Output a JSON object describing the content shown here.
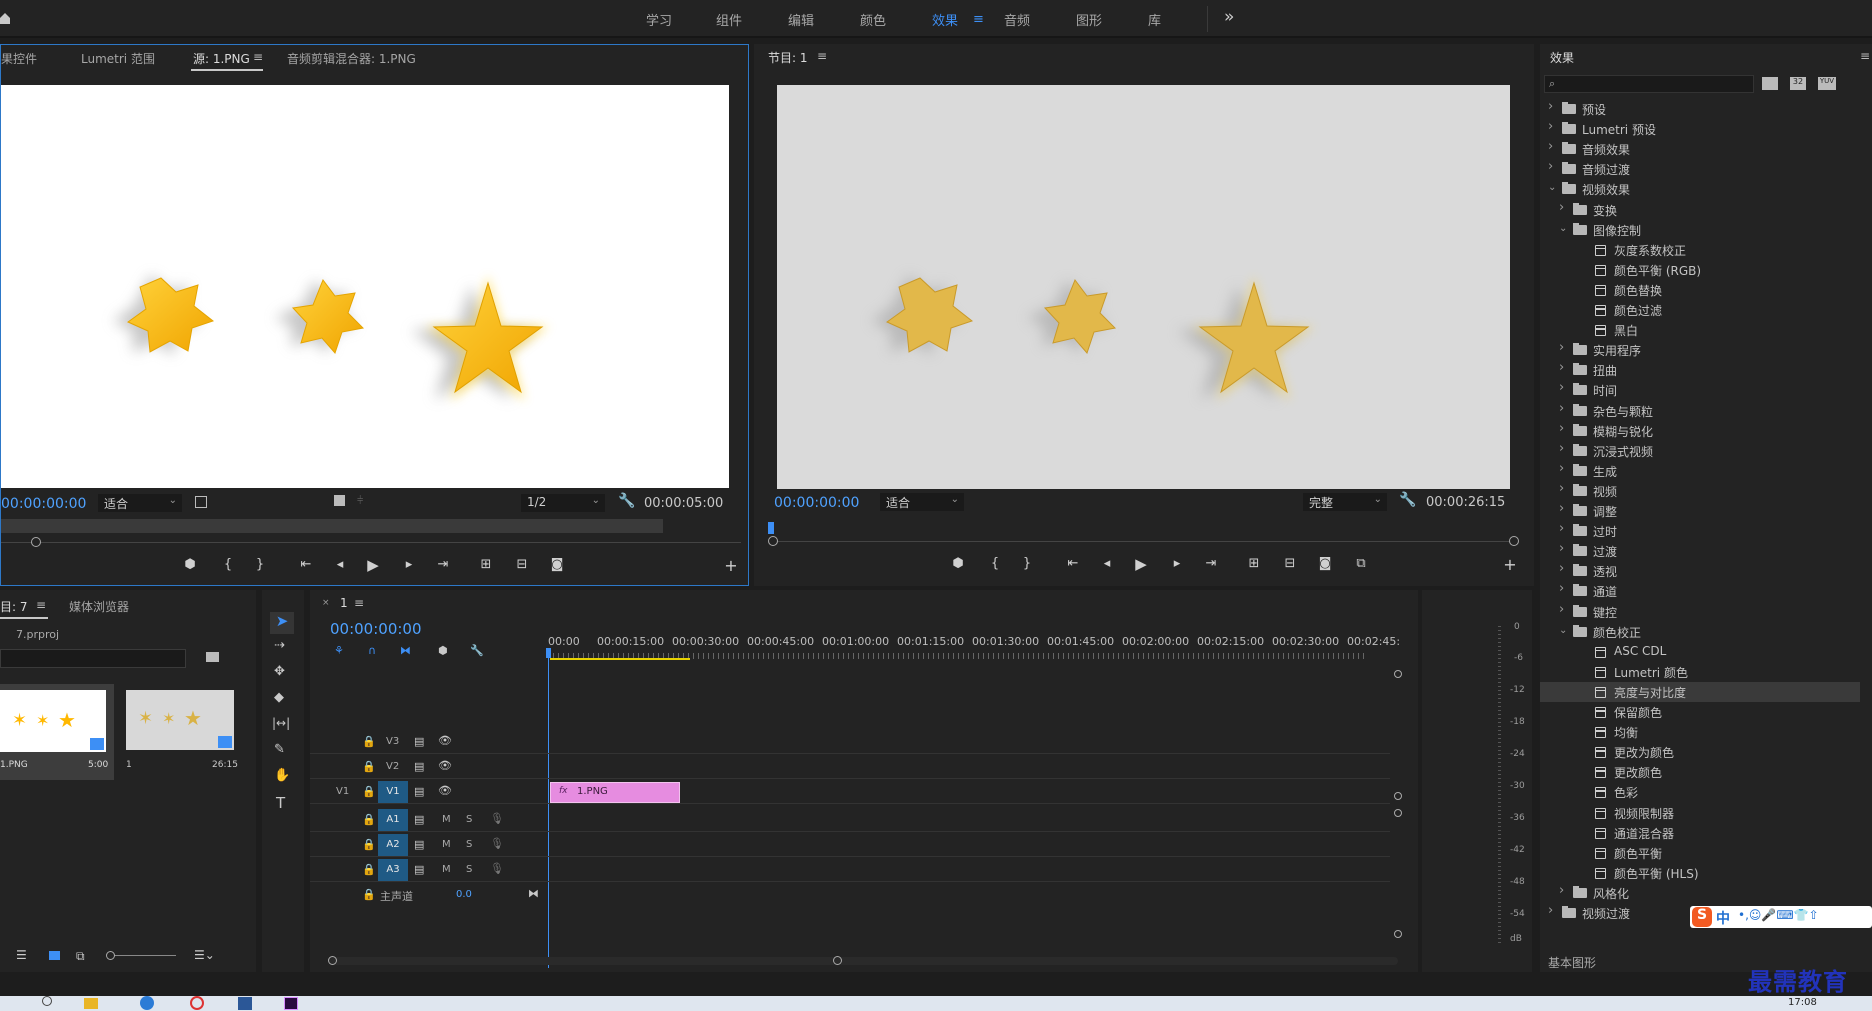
{
  "workspaces": {
    "tabs": [
      "学习",
      "组件",
      "编辑",
      "颜色",
      "效果",
      "音频",
      "图形",
      "库"
    ],
    "active": "效果",
    "more": "»"
  },
  "source_panel": {
    "tabs": [
      "果控件",
      "Lumetri 范围",
      "源: 1.PNG",
      "音频剪辑混合器: 1.PNG"
    ],
    "active_tab": "源: 1.PNG",
    "timecode": "00:00:00:00",
    "fit": "适合",
    "resolution": "1/2",
    "duration": "00:00:05:00"
  },
  "program_panel": {
    "title": "节目: 1",
    "timecode": "00:00:00:00",
    "fit": "适合",
    "quality": "完整",
    "duration": "00:00:26:15"
  },
  "project_panel": {
    "tab": "目: 7",
    "tab2": "媒体浏览器",
    "file": "7.prproj",
    "items": [
      {
        "name": "1.PNG",
        "duration": "5:00"
      },
      {
        "name": "1",
        "duration": "26:15"
      }
    ]
  },
  "timeline": {
    "tab": "1",
    "timecode": "00:00:00:00",
    "ruler": [
      "00:00",
      "00:00:15:00",
      "00:00:30:00",
      "00:00:45:00",
      "00:01:00:00",
      "00:01:15:00",
      "00:01:30:00",
      "00:01:45:00",
      "00:02:00:00",
      "00:02:15:00",
      "00:02:30:00",
      "00:02:45:"
    ],
    "video_tracks": [
      "V3",
      "V2",
      "V1"
    ],
    "source_patch": "V1",
    "audio_tracks": [
      "A1",
      "A2",
      "A3"
    ],
    "m_label": "M",
    "s_label": "S",
    "master_label": "主声道",
    "master_value": "0.0",
    "clip_label": "1.PNG",
    "fx_badge": "fx"
  },
  "meters": {
    "labels": [
      "0",
      "-6",
      "-12",
      "-18",
      "-24",
      "-30",
      "-36",
      "-42",
      "-48",
      "-54",
      "dB"
    ]
  },
  "effects_panel": {
    "title": "效果",
    "search_placeholder": "",
    "badges": [
      "32",
      "YUV"
    ],
    "tree": [
      {
        "label": "预设",
        "level": 0,
        "type": "folder",
        "expanded": false
      },
      {
        "label": "Lumetri 预设",
        "level": 0,
        "type": "folder",
        "expanded": false
      },
      {
        "label": "音频效果",
        "level": 0,
        "type": "folder",
        "expanded": false
      },
      {
        "label": "音频过渡",
        "level": 0,
        "type": "folder",
        "expanded": false
      },
      {
        "label": "视频效果",
        "level": 0,
        "type": "folder",
        "expanded": true
      },
      {
        "label": "变换",
        "level": 1,
        "type": "folder",
        "expanded": false
      },
      {
        "label": "图像控制",
        "level": 1,
        "type": "folder",
        "expanded": true
      },
      {
        "label": "灰度系数校正",
        "level": 2,
        "type": "effect"
      },
      {
        "label": "颜色平衡 (RGB)",
        "level": 2,
        "type": "effect"
      },
      {
        "label": "颜色替换",
        "level": 2,
        "type": "effect"
      },
      {
        "label": "颜色过滤",
        "level": 2,
        "type": "effect"
      },
      {
        "label": "黑白",
        "level": 2,
        "type": "effect"
      },
      {
        "label": "实用程序",
        "level": 1,
        "type": "folder",
        "expanded": false
      },
      {
        "label": "扭曲",
        "level": 1,
        "type": "folder",
        "expanded": false
      },
      {
        "label": "时间",
        "level": 1,
        "type": "folder",
        "expanded": false
      },
      {
        "label": "杂色与颗粒",
        "level": 1,
        "type": "folder",
        "expanded": false
      },
      {
        "label": "模糊与锐化",
        "level": 1,
        "type": "folder",
        "expanded": false
      },
      {
        "label": "沉浸式视频",
        "level": 1,
        "type": "folder",
        "expanded": false
      },
      {
        "label": "生成",
        "level": 1,
        "type": "folder",
        "expanded": false
      },
      {
        "label": "视频",
        "level": 1,
        "type": "folder",
        "expanded": false
      },
      {
        "label": "调整",
        "level": 1,
        "type": "folder",
        "expanded": false
      },
      {
        "label": "过时",
        "level": 1,
        "type": "folder",
        "expanded": false
      },
      {
        "label": "过渡",
        "level": 1,
        "type": "folder",
        "expanded": false
      },
      {
        "label": "透视",
        "level": 1,
        "type": "folder",
        "expanded": false
      },
      {
        "label": "通道",
        "level": 1,
        "type": "folder",
        "expanded": false
      },
      {
        "label": "键控",
        "level": 1,
        "type": "folder",
        "expanded": false
      },
      {
        "label": "颜色校正",
        "level": 1,
        "type": "folder",
        "expanded": true
      },
      {
        "label": "ASC CDL",
        "level": 2,
        "type": "effect"
      },
      {
        "label": "Lumetri 颜色",
        "level": 2,
        "type": "effect"
      },
      {
        "label": "亮度与对比度",
        "level": 2,
        "type": "effect",
        "selected": true
      },
      {
        "label": "保留颜色",
        "level": 2,
        "type": "effect"
      },
      {
        "label": "均衡",
        "level": 2,
        "type": "effect"
      },
      {
        "label": "更改为颜色",
        "level": 2,
        "type": "effect"
      },
      {
        "label": "更改颜色",
        "level": 2,
        "type": "effect"
      },
      {
        "label": "色彩",
        "level": 2,
        "type": "effect"
      },
      {
        "label": "视频限制器",
        "level": 2,
        "type": "effect"
      },
      {
        "label": "通道混合器",
        "level": 2,
        "type": "effect"
      },
      {
        "label": "颜色平衡",
        "level": 2,
        "type": "effect"
      },
      {
        "label": "颜色平衡 (HLS)",
        "level": 2,
        "type": "effect"
      },
      {
        "label": "风格化",
        "level": 1,
        "type": "folder",
        "expanded": false
      },
      {
        "label": "视频过渡",
        "level": 0,
        "type": "folder",
        "expanded": false
      }
    ],
    "footer": "基本图形"
  },
  "ime": {
    "label": "中"
  },
  "watermark": "最需教育",
  "taskbar": {
    "time": "17:08"
  },
  "colors": {
    "accent": "#3d8ff5",
    "timecode": "#4fa2ff",
    "clip": "#e68ce0",
    "star": "#ffb800",
    "track_badge": "#1f5a85"
  }
}
